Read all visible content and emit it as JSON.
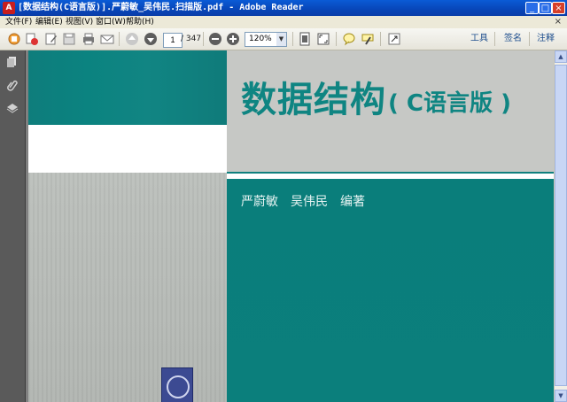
{
  "window": {
    "title": "[数据结构(C语言版)].严蔚敏_吴伟民.扫描版.pdf - Adobe Reader",
    "app_icon_glyph": "A",
    "minimize": "_",
    "maximize": "□",
    "close": "×"
  },
  "menu": {
    "items": [
      "文件(F)",
      "编辑(E)",
      "视图(V)",
      "窗口(W)",
      "帮助(H)"
    ],
    "close": "×"
  },
  "toolbar": {
    "page_current": "1",
    "page_total": "/ 347",
    "zoom": "120%",
    "zoom_arrow": "▼",
    "tools_label": "工具",
    "sign_label": "签名",
    "comment_label": "注释"
  },
  "document": {
    "title_main": "数据结构",
    "title_sub": "( C语言版 )",
    "authors": "严蔚敏　吴伟民　编著"
  },
  "colors": {
    "teal": "#0f8582",
    "titlebar": "#0a5bd6"
  }
}
